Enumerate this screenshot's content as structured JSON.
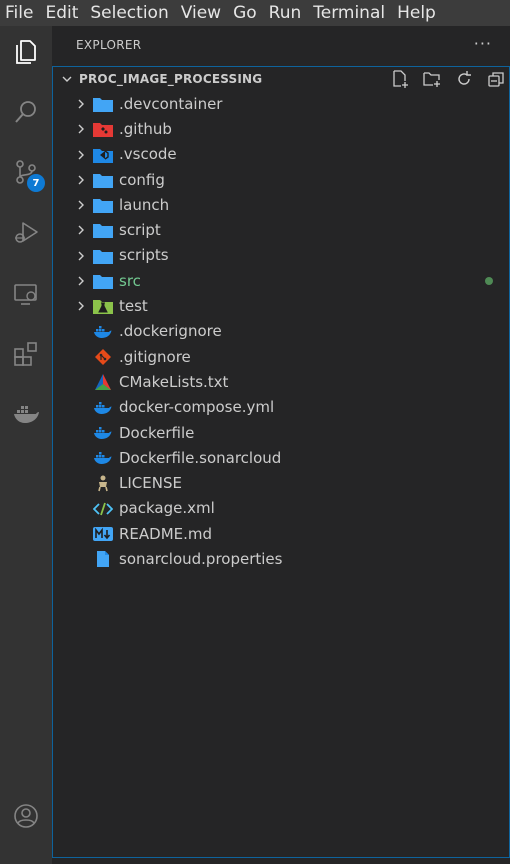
{
  "menu": [
    "File",
    "Edit",
    "Selection",
    "View",
    "Go",
    "Run",
    "Terminal",
    "Help"
  ],
  "activity": {
    "source_control_badge": "7"
  },
  "sidebar": {
    "title": "EXPLORER",
    "more": "···",
    "section_title": "PROC_IMAGE_PROCESSING"
  },
  "tree": [
    {
      "label": ".devcontainer",
      "kind": "folder",
      "icon": "folder-icon"
    },
    {
      "label": ".github",
      "kind": "folder",
      "icon": "github-folder-icon"
    },
    {
      "label": ".vscode",
      "kind": "folder",
      "icon": "vscode-folder-icon"
    },
    {
      "label": "config",
      "kind": "folder",
      "icon": "folder-icon"
    },
    {
      "label": "launch",
      "kind": "folder",
      "icon": "folder-icon"
    },
    {
      "label": "script",
      "kind": "folder",
      "icon": "folder-icon"
    },
    {
      "label": "scripts",
      "kind": "folder",
      "icon": "folder-icon"
    },
    {
      "label": "src",
      "kind": "folder",
      "icon": "folder-icon",
      "modified": true
    },
    {
      "label": "test",
      "kind": "folder",
      "icon": "test-folder-icon"
    },
    {
      "label": ".dockerignore",
      "kind": "file",
      "icon": "docker-icon"
    },
    {
      "label": ".gitignore",
      "kind": "file",
      "icon": "git-icon"
    },
    {
      "label": "CMakeLists.txt",
      "kind": "file",
      "icon": "cmake-icon"
    },
    {
      "label": "docker-compose.yml",
      "kind": "file",
      "icon": "docker-icon"
    },
    {
      "label": "Dockerfile",
      "kind": "file",
      "icon": "docker-icon"
    },
    {
      "label": "Dockerfile.sonarcloud",
      "kind": "file",
      "icon": "docker-icon"
    },
    {
      "label": "LICENSE",
      "kind": "file",
      "icon": "license-icon"
    },
    {
      "label": "package.xml",
      "kind": "file",
      "icon": "xml-icon"
    },
    {
      "label": "README.md",
      "kind": "file",
      "icon": "markdown-icon"
    },
    {
      "label": "sonarcloud.properties",
      "kind": "file",
      "icon": "file-icon"
    }
  ],
  "colors": {
    "accent": "#0e639c",
    "folder": "#42a5f5",
    "modified_text": "#73c991",
    "git_dot": "#4f8a55"
  }
}
